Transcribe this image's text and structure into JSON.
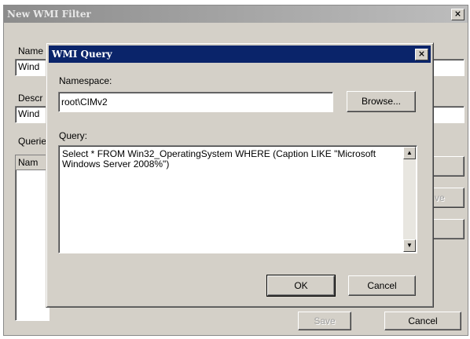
{
  "outer_window": {
    "title": "New WMI Filter",
    "close_glyph": "×",
    "name_label": "Name",
    "name_value": "Wind",
    "description_label": "Descr",
    "description_value": "Wind",
    "queries_label": "Querie",
    "queries_column_header": "Nam",
    "hidden_button_fragment": "ve",
    "save_label": "Save",
    "cancel_label": "Cancel"
  },
  "query_dialog": {
    "title": "WMI Query",
    "close_glyph": "×",
    "namespace_label": "Namespace:",
    "namespace_value": "root\\CIMv2",
    "browse_label": "Browse...",
    "query_label": "Query:",
    "query_value": "Select * FROM Win32_OperatingSystem WHERE (Caption LIKE \"Microsoft Windows Server 2008%\")",
    "scroll_up_glyph": "▲",
    "scroll_down_glyph": "▼",
    "ok_label": "OK",
    "cancel_label": "Cancel"
  },
  "icons": [
    "close-icon",
    "scroll-up-arrow-icon",
    "scroll-down-arrow-icon"
  ],
  "colors": {
    "active_title": "#0a246a",
    "inactive_title": "#8c8c8c",
    "dialog_face": "#d4d0c8"
  }
}
